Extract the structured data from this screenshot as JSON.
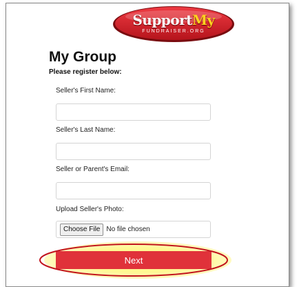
{
  "logo": {
    "word1": "Support",
    "word2": "My",
    "sub": "FUNDRAISER.ORG",
    "color_red": "#d8262f",
    "color_yellow": "#ffd21f"
  },
  "title": "My Group",
  "subtitle": "Please register below:",
  "fields": {
    "first_name": {
      "label": "Seller's First Name:",
      "value": ""
    },
    "last_name": {
      "label": "Seller's Last Name:",
      "value": ""
    },
    "email": {
      "label": "Seller or Parent's Email:",
      "value": ""
    },
    "photo": {
      "label": "Upload Seller's Photo:",
      "button": "Choose File",
      "status": "No file chosen"
    }
  },
  "next_button": {
    "label": "Next",
    "color": "#e0323a"
  },
  "highlight_color": "#c2151e"
}
